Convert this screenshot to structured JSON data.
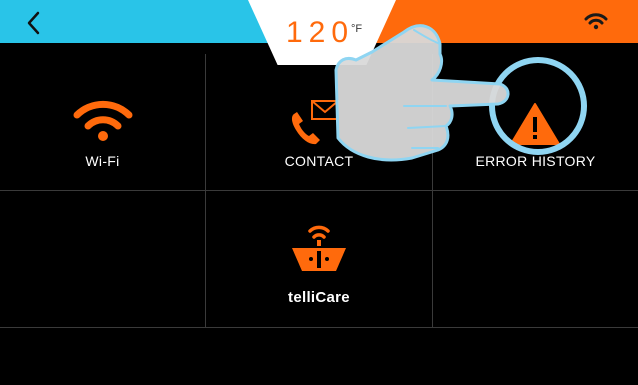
{
  "header": {
    "temperature": "120",
    "temperature_unit": "°F",
    "back_icon": "chevron-left-icon",
    "status_icon": "wifi-icon"
  },
  "menu": {
    "wifi": {
      "label": "Wi-Fi",
      "icon": "wifi-icon"
    },
    "contact": {
      "label": "CONTACT",
      "icon": "phone-envelope-icon"
    },
    "error_history": {
      "label": "ERROR HISTORY",
      "icon": "warning-icon"
    },
    "tellicare": {
      "label_regular": "telli",
      "label_bold": "Care",
      "icon": "tellicare-icon"
    }
  },
  "colors": {
    "accent_orange": "#ff6a0c",
    "header_blue": "#29c4e8",
    "background": "#000000",
    "divider": "#3a3a3a"
  },
  "overlay": {
    "gesture": "hand-pointer-icon",
    "highlight": "circle-highlight"
  }
}
